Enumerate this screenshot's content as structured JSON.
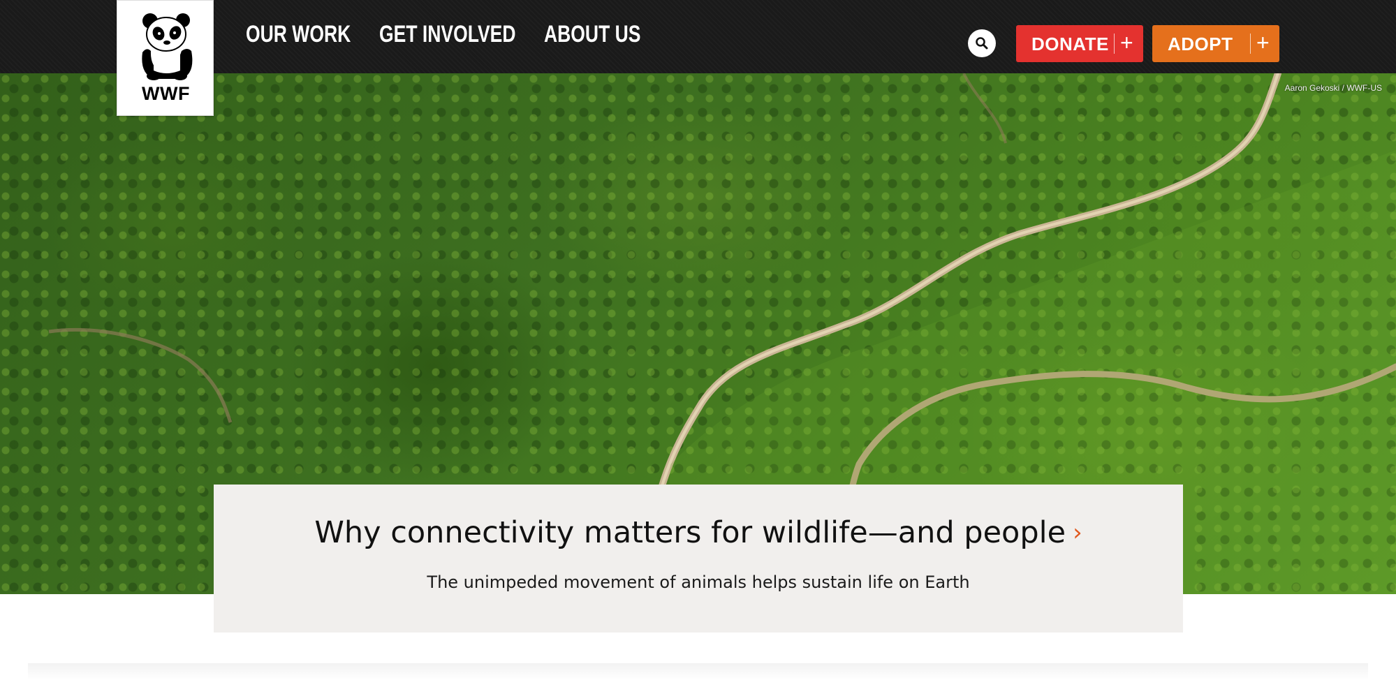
{
  "header": {
    "logo_text": "WWF",
    "nav": [
      {
        "label": "OUR WORK"
      },
      {
        "label": "GET INVOLVED"
      },
      {
        "label": "ABOUT US"
      }
    ],
    "search_icon": "search-icon",
    "donate": {
      "label": "DONATE",
      "icon": "plus-icon"
    },
    "adopt": {
      "label": "ADOPT",
      "icon": "plus-icon"
    },
    "colors": {
      "bar": "#1a1a1a",
      "donate": "#e4322f",
      "adopt": "#e5701c"
    }
  },
  "hero": {
    "photo_credit": "Aaron Gekoski / WWF-US"
  },
  "feature": {
    "title": "Why connectivity matters for wildlife—and people",
    "title_icon": "chevron-right-icon",
    "subtitle": "The unimpeded movement of animals helps sustain life on Earth",
    "accent": "#e0581e"
  }
}
